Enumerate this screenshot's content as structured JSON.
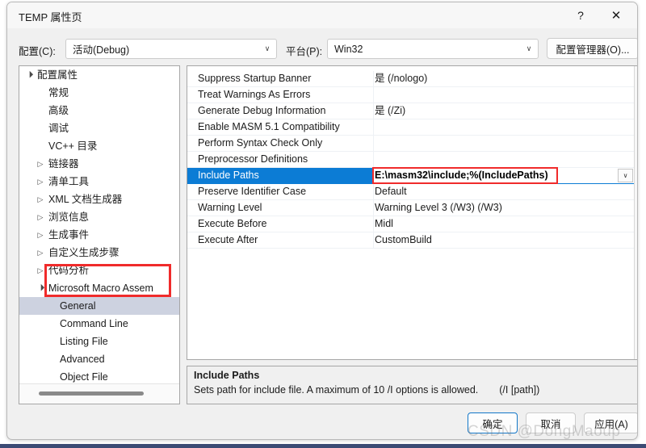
{
  "window": {
    "title": "TEMP 属性页",
    "help_icon": "?",
    "close_icon": "✕"
  },
  "toolbar": {
    "configuration_label": "配置(C):",
    "configuration_value": "活动(Debug)",
    "platform_label": "平台(P):",
    "platform_value": "Win32",
    "config_manager_label": "配置管理器(O)...",
    "chevron_icon": "∨"
  },
  "tree": {
    "items": [
      {
        "label": "配置属性",
        "indent": 0,
        "twisty": "open",
        "selected": false
      },
      {
        "label": "常规",
        "indent": 1,
        "twisty": "none",
        "selected": false
      },
      {
        "label": "高级",
        "indent": 1,
        "twisty": "none",
        "selected": false
      },
      {
        "label": "调试",
        "indent": 1,
        "twisty": "none",
        "selected": false
      },
      {
        "label": "VC++ 目录",
        "indent": 1,
        "twisty": "none",
        "selected": false
      },
      {
        "label": "链接器",
        "indent": 1,
        "twisty": "closed",
        "selected": false
      },
      {
        "label": "清单工具",
        "indent": 1,
        "twisty": "closed",
        "selected": false
      },
      {
        "label": "XML 文档生成器",
        "indent": 1,
        "twisty": "closed",
        "selected": false
      },
      {
        "label": "浏览信息",
        "indent": 1,
        "twisty": "closed",
        "selected": false
      },
      {
        "label": "生成事件",
        "indent": 1,
        "twisty": "closed",
        "selected": false
      },
      {
        "label": "自定义生成步骤",
        "indent": 1,
        "twisty": "closed",
        "selected": false
      },
      {
        "label": "代码分析",
        "indent": 1,
        "twisty": "closed",
        "selected": false
      },
      {
        "label": "Microsoft Macro Assem",
        "indent": 1,
        "twisty": "open",
        "selected": false
      },
      {
        "label": "General",
        "indent": 2,
        "twisty": "none",
        "selected": true
      },
      {
        "label": "Command Line",
        "indent": 2,
        "twisty": "none",
        "selected": false
      },
      {
        "label": "Listing File",
        "indent": 2,
        "twisty": "none",
        "selected": false
      },
      {
        "label": "Advanced",
        "indent": 2,
        "twisty": "none",
        "selected": false
      },
      {
        "label": "Object File",
        "indent": 2,
        "twisty": "none",
        "selected": false
      }
    ]
  },
  "grid": {
    "rows": [
      {
        "name": "Suppress Startup Banner",
        "value": "是 (/nologo)",
        "selected": false
      },
      {
        "name": "Treat Warnings As Errors",
        "value": "",
        "selected": false
      },
      {
        "name": "Generate Debug Information",
        "value": "是 (/Zi)",
        "selected": false
      },
      {
        "name": "Enable MASM 5.1 Compatibility",
        "value": "",
        "selected": false
      },
      {
        "name": "Perform Syntax Check Only",
        "value": "",
        "selected": false
      },
      {
        "name": "Preprocessor Definitions",
        "value": "",
        "selected": false
      },
      {
        "name": "Include Paths",
        "value": "E:\\masm32\\include;%(IncludePaths)",
        "selected": true
      },
      {
        "name": "Preserve Identifier Case",
        "value": "Default",
        "selected": false
      },
      {
        "name": "Warning Level",
        "value": "Warning Level 3 (/W3) (/W3)",
        "selected": false
      },
      {
        "name": "Execute Before",
        "value": "Midl",
        "selected": false
      },
      {
        "name": "Execute After",
        "value": "CustomBuild",
        "selected": false
      }
    ],
    "editor_value": "E:\\masm32\\include;%(IncludePaths)",
    "editor_dropdown_icon": "∨"
  },
  "description": {
    "title": "Include Paths",
    "text": "Sets path for include file. A maximum of 10 /I options is allowed.",
    "switch": "(/I [path])"
  },
  "footer": {
    "ok_label": "确定",
    "cancel_label": "取消",
    "apply_label": "应用(A)"
  },
  "watermark": {
    "text": "CSDN @DongMaoup"
  },
  "colors": {
    "selection_blue": "#0c7cd5",
    "tree_selection": "#cdd2e0",
    "annotation_red": "#f02b2b",
    "dialog_bg": "#f0f0f0",
    "taskbar": "#3b4a74"
  }
}
